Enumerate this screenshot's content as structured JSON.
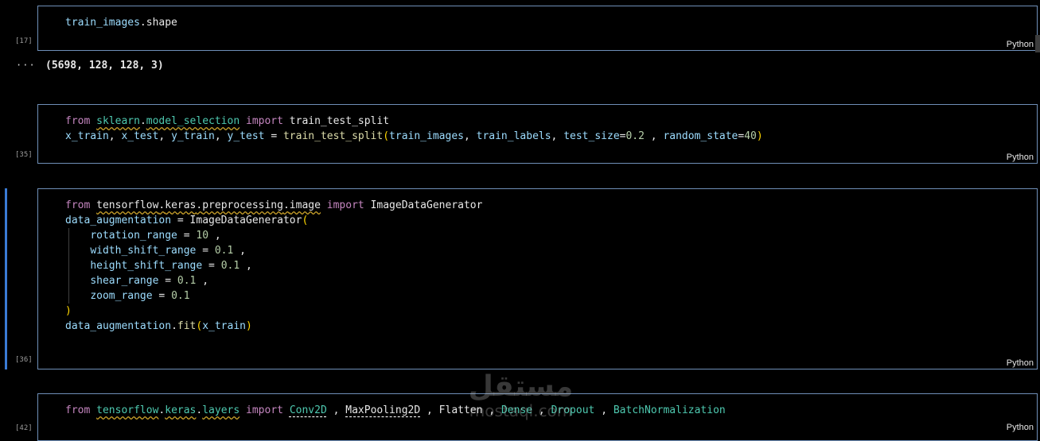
{
  "cells": [
    {
      "exec_count": "[17]",
      "language": "Python",
      "lines": [
        [
          {
            "t": "train_images",
            "c": "var"
          },
          {
            "t": ".shape",
            "c": "plain"
          }
        ]
      ]
    },
    {
      "exec_count": "[35]",
      "language": "Python",
      "lines": [
        [
          {
            "t": "from ",
            "c": "kw"
          },
          {
            "t": "sklearn",
            "c": "mod"
          },
          {
            "t": ".",
            "c": "plain"
          },
          {
            "t": "model_selection",
            "c": "mod"
          },
          {
            "t": " import ",
            "c": "kw"
          },
          {
            "t": "train_test_split",
            "c": "plain"
          }
        ],
        [
          {
            "t": "x_train",
            "c": "var"
          },
          {
            "t": ", ",
            "c": "plain"
          },
          {
            "t": "x_test",
            "c": "var"
          },
          {
            "t": ", ",
            "c": "plain"
          },
          {
            "t": "y_train",
            "c": "var"
          },
          {
            "t": ", ",
            "c": "plain"
          },
          {
            "t": "y_test",
            "c": "var"
          },
          {
            "t": " = ",
            "c": "plain"
          },
          {
            "t": "train_test_split",
            "c": "fn"
          },
          {
            "t": "(",
            "c": "paren"
          },
          {
            "t": "train_images",
            "c": "var"
          },
          {
            "t": ", ",
            "c": "plain"
          },
          {
            "t": "train_labels",
            "c": "var"
          },
          {
            "t": ", ",
            "c": "plain"
          },
          {
            "t": "test_size",
            "c": "var"
          },
          {
            "t": "=",
            "c": "plain"
          },
          {
            "t": "0.2",
            "c": "num"
          },
          {
            "t": " , ",
            "c": "plain"
          },
          {
            "t": "random_state",
            "c": "var"
          },
          {
            "t": "=",
            "c": "plain"
          },
          {
            "t": "40",
            "c": "num"
          },
          {
            "t": ")",
            "c": "paren"
          }
        ]
      ]
    },
    {
      "exec_count": "[36]",
      "language": "Python",
      "lines": [
        [
          {
            "t": "from ",
            "c": "kw"
          },
          {
            "t": "tensorflow",
            "c": "modw"
          },
          {
            "t": ".",
            "c": "modw"
          },
          {
            "t": "keras",
            "c": "modw"
          },
          {
            "t": ".",
            "c": "modw"
          },
          {
            "t": "preprocessing",
            "c": "modw"
          },
          {
            "t": ".",
            "c": "modw"
          },
          {
            "t": "image",
            "c": "modw"
          },
          {
            "t": " import ",
            "c": "kw"
          },
          {
            "t": "ImageDataGenerator",
            "c": "plain"
          }
        ],
        [
          {
            "t": "data_augmentation",
            "c": "var"
          },
          {
            "t": " = ",
            "c": "plain"
          },
          {
            "t": "ImageDataGenerator",
            "c": "plain"
          },
          {
            "t": "(",
            "c": "paren"
          }
        ],
        [
          {
            "t": "    ",
            "c": "plain"
          },
          {
            "t": "rotation_range",
            "c": "var"
          },
          {
            "t": " = ",
            "c": "plain"
          },
          {
            "t": "10",
            "c": "num"
          },
          {
            "t": " ,",
            "c": "plain"
          }
        ],
        [
          {
            "t": "    ",
            "c": "plain"
          },
          {
            "t": "width_shift_range",
            "c": "var"
          },
          {
            "t": " = ",
            "c": "plain"
          },
          {
            "t": "0.1",
            "c": "num"
          },
          {
            "t": " ,",
            "c": "plain"
          }
        ],
        [
          {
            "t": "    ",
            "c": "plain"
          },
          {
            "t": "height_shift_range",
            "c": "var"
          },
          {
            "t": " = ",
            "c": "plain"
          },
          {
            "t": "0.1",
            "c": "num"
          },
          {
            "t": " ,",
            "c": "plain"
          }
        ],
        [
          {
            "t": "    ",
            "c": "plain"
          },
          {
            "t": "shear_range",
            "c": "var"
          },
          {
            "t": " = ",
            "c": "plain"
          },
          {
            "t": "0.1",
            "c": "num"
          },
          {
            "t": " ,",
            "c": "plain"
          }
        ],
        [
          {
            "t": "    ",
            "c": "plain"
          },
          {
            "t": "zoom_range",
            "c": "var"
          },
          {
            "t": " = ",
            "c": "plain"
          },
          {
            "t": "0.1",
            "c": "num"
          }
        ],
        [
          {
            "t": ")",
            "c": "paren"
          }
        ],
        [
          {
            "t": "data_augmentation",
            "c": "var"
          },
          {
            "t": ".",
            "c": "plain"
          },
          {
            "t": "fit",
            "c": "fn"
          },
          {
            "t": "(",
            "c": "paren"
          },
          {
            "t": "x_train",
            "c": "var"
          },
          {
            "t": ")",
            "c": "paren"
          }
        ]
      ]
    },
    {
      "exec_count": "[42]",
      "language": "Python",
      "lines": [
        [
          {
            "t": "from ",
            "c": "kw"
          },
          {
            "t": "tensorflow",
            "c": "mod"
          },
          {
            "t": ".",
            "c": "plain"
          },
          {
            "t": "keras",
            "c": "mod"
          },
          {
            "t": ".",
            "c": "plain"
          },
          {
            "t": "layers",
            "c": "mod"
          },
          {
            "t": " import ",
            "c": "kw"
          },
          {
            "t": "Conv2D",
            "c": "clsd"
          },
          {
            "t": " , ",
            "c": "plain"
          },
          {
            "t": "MaxPooling2D",
            "c": "plaind"
          },
          {
            "t": " , ",
            "c": "plain"
          },
          {
            "t": "Flatten",
            "c": "plain"
          },
          {
            "t": " , ",
            "c": "plain"
          },
          {
            "t": "Dense",
            "c": "cls"
          },
          {
            "t": " , ",
            "c": "plain"
          },
          {
            "t": "Dropout",
            "c": "cls"
          },
          {
            "t": " , ",
            "c": "plain"
          },
          {
            "t": "BatchNormalization",
            "c": "cls"
          }
        ]
      ]
    }
  ],
  "output": {
    "menu_label": "···",
    "text": "(5698, 128, 128, 3)"
  },
  "watermark": {
    "arabic": "مستقل",
    "latin": "mostaql.com"
  }
}
